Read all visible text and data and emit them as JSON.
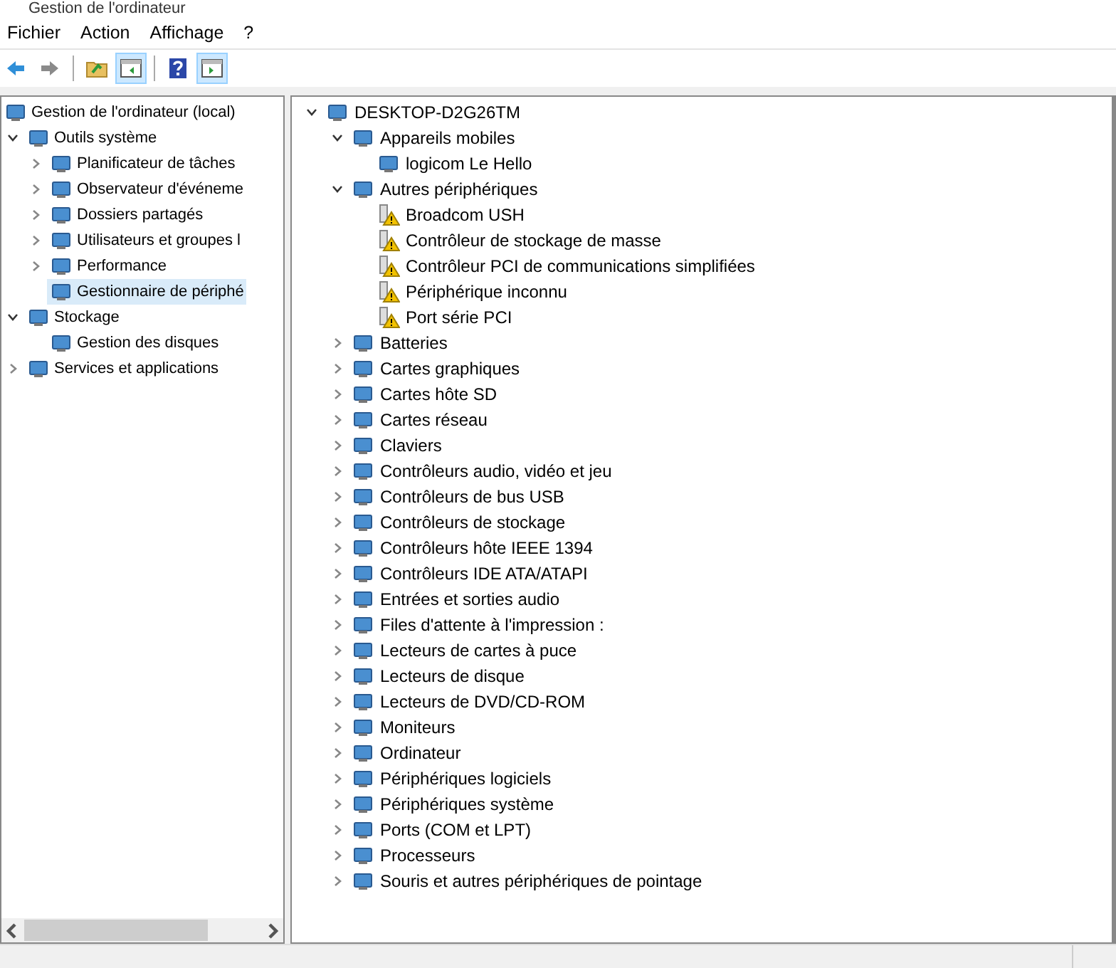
{
  "window": {
    "title": "Gestion de l'ordinateur"
  },
  "menu": [
    "Fichier",
    "Action",
    "Affichage",
    "?"
  ],
  "toolbar": [
    {
      "kind": "back",
      "pressed": false
    },
    {
      "kind": "forward",
      "pressed": false
    },
    {
      "kind": "separator"
    },
    {
      "kind": "up",
      "pressed": false
    },
    {
      "kind": "tree",
      "pressed": true
    },
    {
      "kind": "separator"
    },
    {
      "kind": "help",
      "pressed": false
    },
    {
      "kind": "pane",
      "pressed": true
    }
  ],
  "console_tree": [
    {
      "label": "Gestion de l'ordinateur (local)",
      "selected": false,
      "children": [
        {
          "label": "Outils système",
          "expanded": true,
          "selected": false,
          "children": [
            {
              "label": "Planificateur de tâches",
              "expanded": false,
              "selected": false
            },
            {
              "label": "Observateur d'événeme",
              "expanded": false,
              "selected": false
            },
            {
              "label": "Dossiers partagés",
              "expanded": false,
              "selected": false
            },
            {
              "label": "Utilisateurs et groupes l",
              "expanded": false,
              "selected": false
            },
            {
              "label": "Performance",
              "expanded": false,
              "selected": false
            },
            {
              "label": "Gestionnaire de périphé",
              "selected": true
            }
          ]
        },
        {
          "label": "Stockage",
          "expanded": true,
          "selected": false,
          "children": [
            {
              "label": "Gestion des disques",
              "selected": false
            }
          ]
        },
        {
          "label": "Services et applications",
          "expanded": false,
          "selected": false
        }
      ]
    }
  ],
  "device_tree": [
    {
      "label": "DESKTOP-D2G26TM",
      "expanded": true,
      "children": [
        {
          "label": "Appareils mobiles",
          "expanded": true,
          "children": [
            {
              "label": "logicom Le Hello",
              "warning": false
            }
          ]
        },
        {
          "label": "Autres périphériques",
          "expanded": true,
          "children": [
            {
              "label": "Broadcom USH",
              "warning": true
            },
            {
              "label": "Contrôleur de stockage de masse",
              "warning": true
            },
            {
              "label": "Contrôleur PCI de communications simplifiées",
              "warning": true
            },
            {
              "label": "Périphérique inconnu",
              "warning": true
            },
            {
              "label": "Port série PCI",
              "warning": true
            }
          ]
        },
        {
          "label": "Batteries",
          "expanded": false
        },
        {
          "label": "Cartes graphiques",
          "expanded": false
        },
        {
          "label": "Cartes hôte SD",
          "expanded": false
        },
        {
          "label": "Cartes réseau",
          "expanded": false
        },
        {
          "label": "Claviers",
          "expanded": false
        },
        {
          "label": "Contrôleurs audio, vidéo et jeu",
          "expanded": false
        },
        {
          "label": "Contrôleurs de bus USB",
          "expanded": false
        },
        {
          "label": "Contrôleurs de stockage",
          "expanded": false
        },
        {
          "label": "Contrôleurs hôte IEEE 1394",
          "expanded": false
        },
        {
          "label": "Contrôleurs IDE ATA/ATAPI",
          "expanded": false
        },
        {
          "label": "Entrées et sorties audio",
          "expanded": false
        },
        {
          "label": "Files d'attente à l'impression :",
          "expanded": false
        },
        {
          "label": "Lecteurs de cartes à puce",
          "expanded": false
        },
        {
          "label": "Lecteurs de disque",
          "expanded": false
        },
        {
          "label": "Lecteurs de DVD/CD-ROM",
          "expanded": false
        },
        {
          "label": "Moniteurs",
          "expanded": false
        },
        {
          "label": "Ordinateur",
          "expanded": false
        },
        {
          "label": "Périphériques logiciels",
          "expanded": false
        },
        {
          "label": "Périphériques système",
          "expanded": false
        },
        {
          "label": "Ports (COM et LPT)",
          "expanded": false
        },
        {
          "label": "Processeurs",
          "expanded": false
        },
        {
          "label": "Souris et autres périphériques de pointage",
          "expanded": false
        }
      ]
    }
  ]
}
